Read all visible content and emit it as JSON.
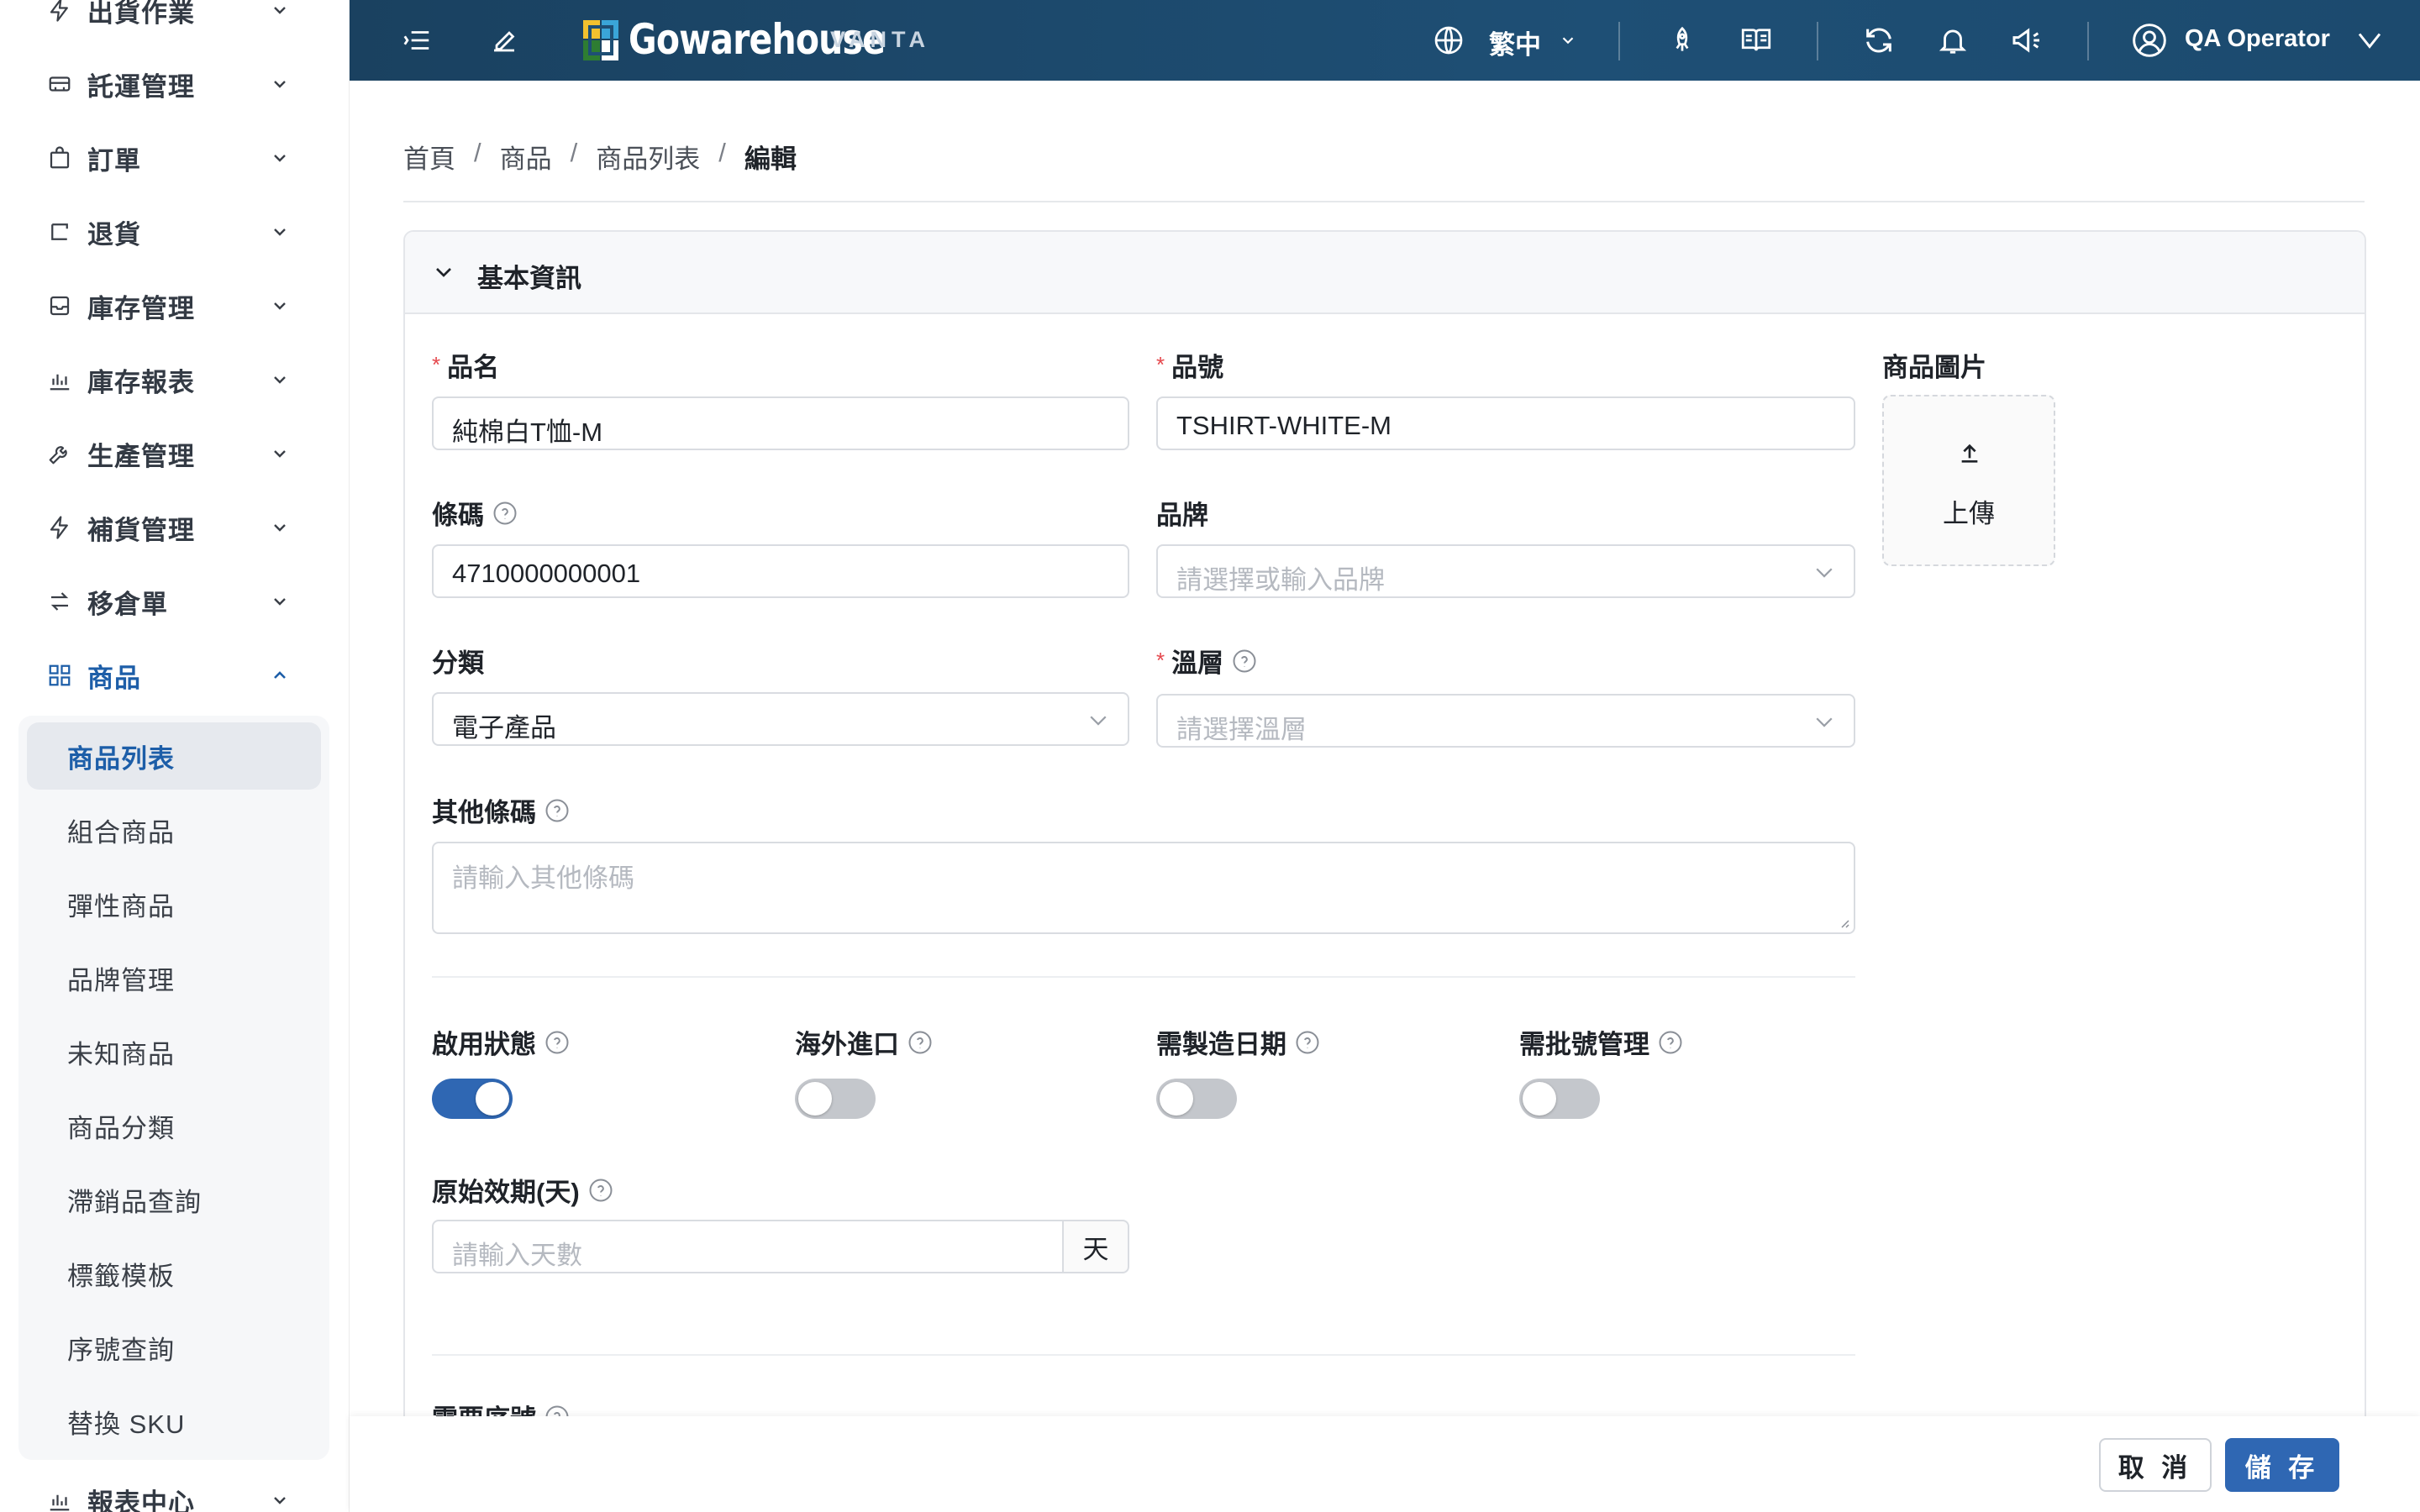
{
  "sidebar": {
    "items": [
      {
        "label": "出貨作業",
        "icon": "bolt-icon"
      },
      {
        "label": "託運管理",
        "icon": "truck-icon"
      },
      {
        "label": "訂單",
        "icon": "bag-icon"
      },
      {
        "label": "退貨",
        "icon": "return-icon"
      },
      {
        "label": "庫存管理",
        "icon": "inbox-icon"
      },
      {
        "label": "庫存報表",
        "icon": "bar-chart-icon"
      },
      {
        "label": "生產管理",
        "icon": "wrench-icon"
      },
      {
        "label": "補貨管理",
        "icon": "bolt-icon"
      },
      {
        "label": "移倉單",
        "icon": "swap-icon"
      },
      {
        "label": "商品",
        "icon": "grid-icon"
      },
      {
        "label": "報表中心",
        "icon": "bar-chart-icon"
      }
    ],
    "submenu": [
      "商品列表",
      "組合商品",
      "彈性商品",
      "品牌管理",
      "未知商品",
      "商品分類",
      "滯銷品查詢",
      "標籤模板",
      "序號查詢",
      "替換 SKU"
    ]
  },
  "header": {
    "logo": "Gowarehouse",
    "logo_sub": "VANTA",
    "language": "繁中",
    "user": "QA Operator"
  },
  "breadcrumb": [
    "首頁",
    "商品",
    "商品列表",
    "編輯"
  ],
  "section": {
    "title": "基本資訊"
  },
  "form": {
    "name_label": "品名",
    "name_value": "純棉白T恤-M",
    "sku_label": "品號",
    "sku_value": "TSHIRT-WHITE-M",
    "image_label": "商品圖片",
    "upload_label": "上傳",
    "barcode_label": "條碼",
    "barcode_value": "4710000000001",
    "brand_label": "品牌",
    "brand_placeholder": "請選擇或輸入品牌",
    "category_label": "分類",
    "category_value": "電子產品",
    "temp_label": "溫層",
    "temp_placeholder": "請選擇溫層",
    "other_barcode_label": "其他條碼",
    "other_barcode_placeholder": "請輸入其他條碼",
    "enabled_label": "啟用狀態",
    "enabled": true,
    "import_label": "海外進口",
    "import": false,
    "mfg_date_label": "需製造日期",
    "mfg_date": false,
    "batch_label": "需批號管理",
    "batch": false,
    "shelf_life_label": "原始效期(天)",
    "shelf_life_placeholder": "請輸入天數",
    "shelf_life_unit": "天",
    "serial_label": "需要序號"
  },
  "footer": {
    "cancel": "取 消",
    "save": "儲 存"
  },
  "colors": {
    "header_bg": "#1e4f75",
    "primary": "#2f67b3",
    "active_text": "#1d5ea8",
    "required": "#e5484d"
  }
}
